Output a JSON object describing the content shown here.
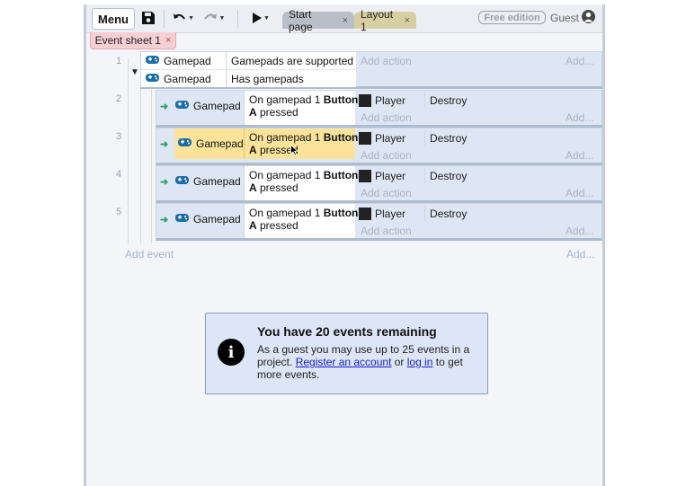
{
  "toolbar": {
    "menu_label": "Menu",
    "tabs": [
      {
        "label": "Start page",
        "close": "×"
      },
      {
        "label": "Layout 1",
        "close": "×"
      }
    ],
    "edition_badge": "Free edition",
    "user_label": "Guest"
  },
  "sheet_tab": {
    "label": "Event sheet 1",
    "close": "×"
  },
  "events": [
    {
      "number": "1",
      "conditions": [
        {
          "object": "Gamepad",
          "text": "Gamepads are supported"
        },
        {
          "object": "Gamepad",
          "text": "Has gamepads"
        }
      ],
      "add_action": "Add action",
      "add_more": "Add..."
    },
    {
      "number": "2",
      "object": "Gamepad",
      "cond_line1": "On gamepad 1 ",
      "cond_bold1": "Button",
      "cond_bold2": "A",
      "cond_line2": " pressed",
      "action_object": "Player",
      "action": "Destroy",
      "add_action": "Add action",
      "add_more": "Add..."
    },
    {
      "number": "3",
      "object": "Gamepad",
      "selected": true,
      "cond_line1": "On gamepad 1 ",
      "cond_bold1": "Button",
      "cond_bold2": "A",
      "cond_line2": " pressed",
      "action_object": "Player",
      "action": "Destroy",
      "add_action": "Add action",
      "add_more": "Add..."
    },
    {
      "number": "4",
      "object": "Gamepad",
      "cond_line1": "On gamepad 1 ",
      "cond_bold1": "Button",
      "cond_bold2": "A",
      "cond_line2": " pressed",
      "action_object": "Player",
      "action": "Destroy",
      "add_action": "Add action",
      "add_more": "Add..."
    },
    {
      "number": "5",
      "object": "Gamepad",
      "cond_line1": "On gamepad 1 ",
      "cond_bold1": "Button",
      "cond_bold2": "A",
      "cond_line2": " pressed",
      "action_object": "Player",
      "action": "Destroy",
      "add_action": "Add action",
      "add_more": "Add..."
    }
  ],
  "add_event": "Add event",
  "add_event_more": "Add...",
  "notice": {
    "title": "You have 20 events remaining",
    "text1": "As a guest you may use up to 25 events in a project. ",
    "link1": "Register an account",
    "text2": " or ",
    "link2": "log in",
    "text3": " to get more events."
  },
  "colors": {
    "selected_condition": "#fbe49a",
    "event_block": "#dde6f2",
    "sheet_tab": "#f6cfd3",
    "layout_tab": "#d7cfa2",
    "link": "#1a1ad0"
  }
}
